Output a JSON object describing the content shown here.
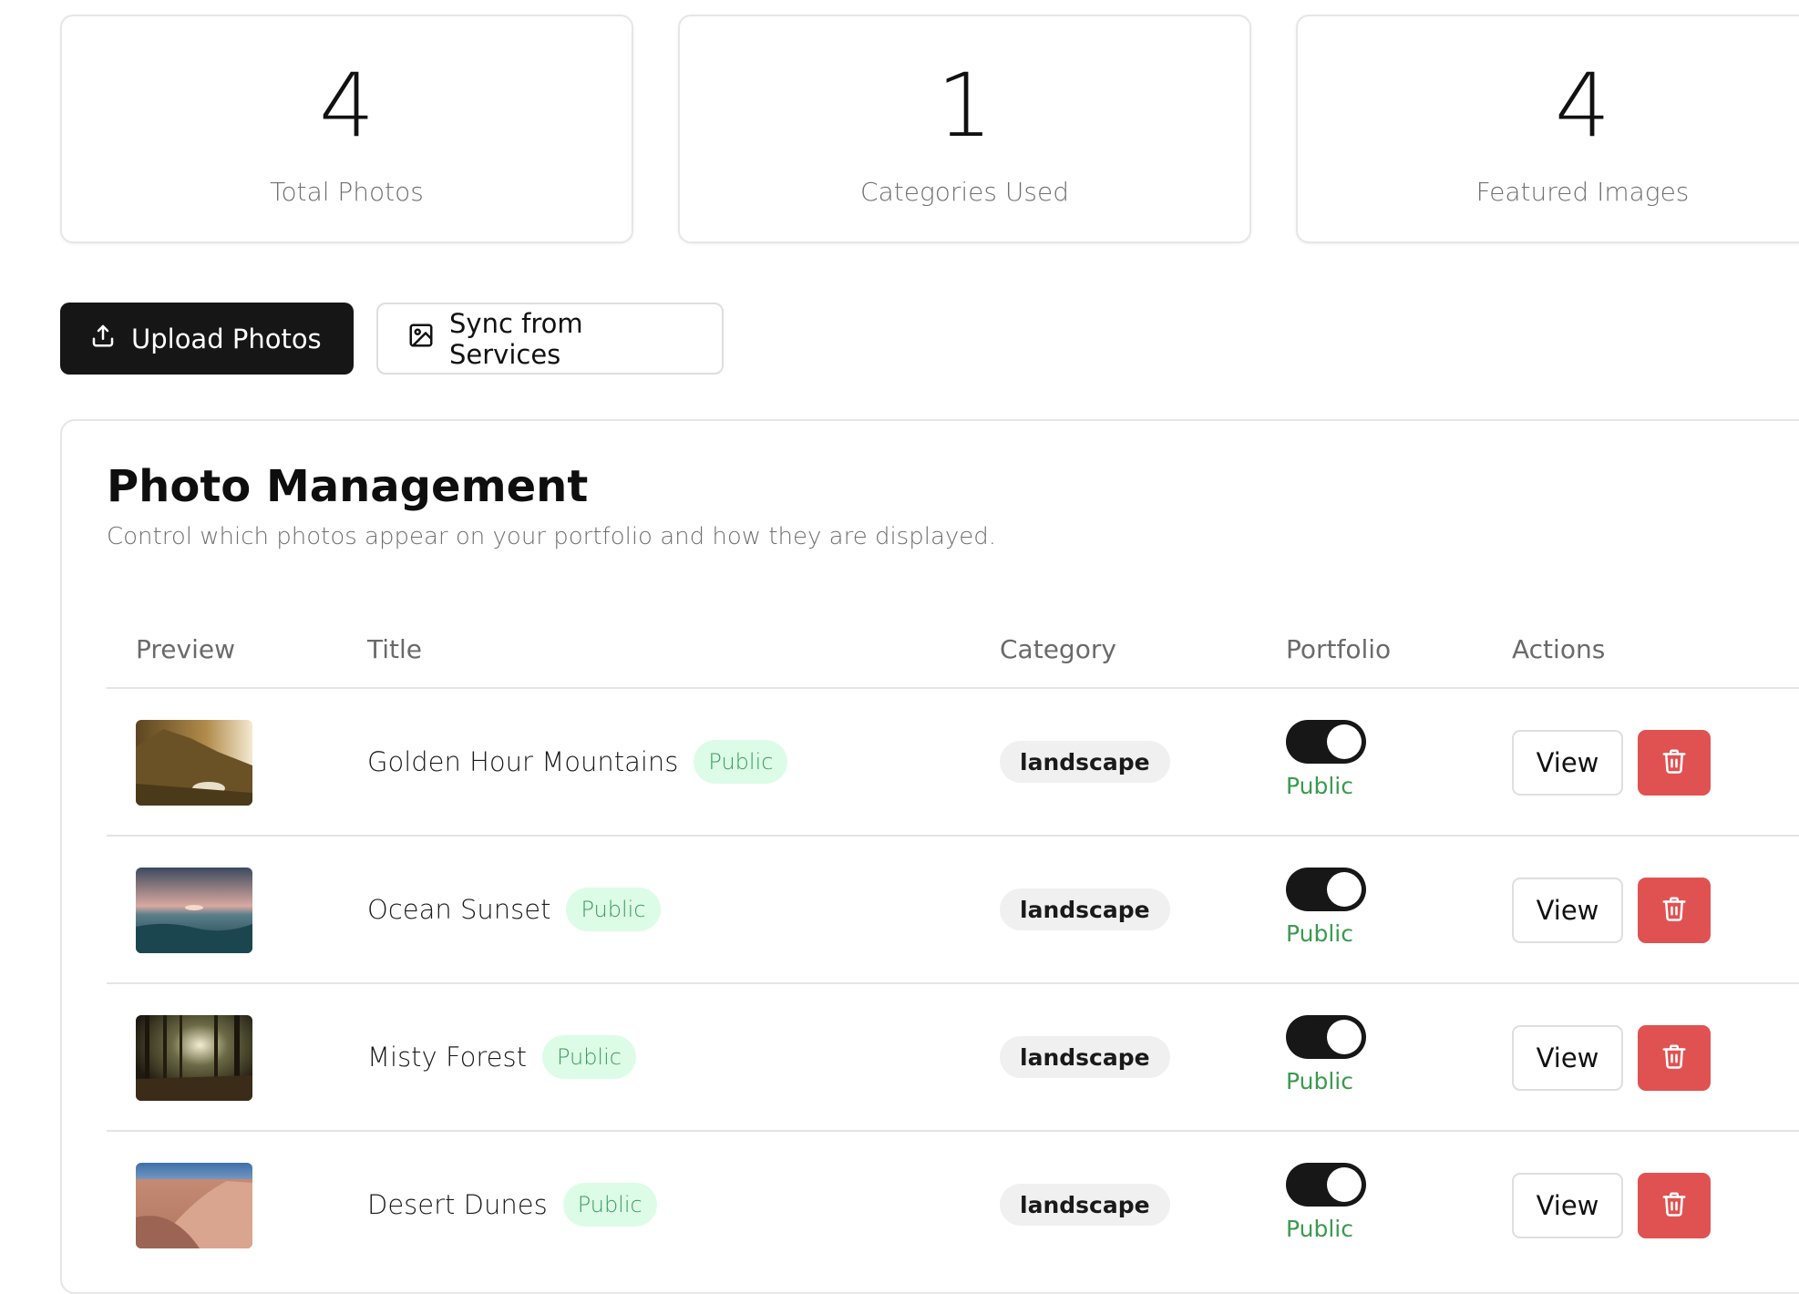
{
  "stats": [
    {
      "value": "4",
      "label": "Total Photos"
    },
    {
      "value": "1",
      "label": "Categories Used"
    },
    {
      "value": "4",
      "label": "Featured Images"
    }
  ],
  "toolbar": {
    "upload_label": "Upload Photos",
    "sync_label": "Sync from Services"
  },
  "panel": {
    "title": "Photo Management",
    "subtitle": "Control which photos appear on your portfolio and how they are displayed."
  },
  "table": {
    "headers": {
      "preview": "Preview",
      "title": "Title",
      "category": "Category",
      "portfolio": "Portfolio",
      "actions": "Actions"
    },
    "rows": [
      {
        "title": "Golden Hour Mountains",
        "visibility": "Public",
        "category": "landscape",
        "portfolio_on": true,
        "portfolio_label": "Public",
        "view_label": "View"
      },
      {
        "title": "Ocean Sunset",
        "visibility": "Public",
        "category": "landscape",
        "portfolio_on": true,
        "portfolio_label": "Public",
        "view_label": "View"
      },
      {
        "title": "Misty Forest",
        "visibility": "Public",
        "category": "landscape",
        "portfolio_on": true,
        "portfolio_label": "Public",
        "view_label": "View"
      },
      {
        "title": "Desert Dunes",
        "visibility": "Public",
        "category": "landscape",
        "portfolio_on": true,
        "portfolio_label": "Public",
        "view_label": "View"
      }
    ]
  },
  "icons": {
    "upload": "upload-icon",
    "sync": "image-icon",
    "delete": "trash-icon"
  },
  "colors": {
    "primary_button": "#161616",
    "public_pill_bg": "#dcfce7",
    "public_text": "#3a9a4e",
    "delete_button": "#e05252",
    "toggle_on": "#171717"
  }
}
